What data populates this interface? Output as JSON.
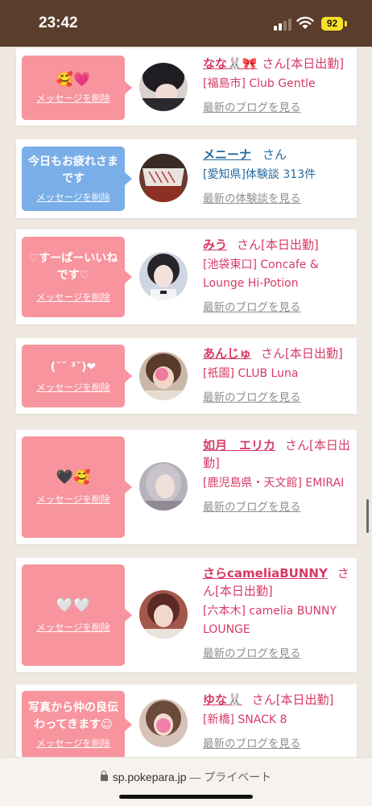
{
  "status": {
    "time": "23:42",
    "battery": "92"
  },
  "cards": [
    {
      "message": "🥰💗",
      "delete": "メッセージを削除",
      "name": "なな🐰🎀",
      "san": "さん",
      "tag": "[本日出勤]",
      "shop": "[福島市] Club Gentle",
      "link": "最新のブログを見る"
    },
    {
      "message": "今日もお疲れさまです",
      "delete": "メッセージを削除",
      "name": "メニーナ",
      "san": "さん",
      "tag": "",
      "shop": "[愛知県]体験談 313件",
      "link": "最新の体験談を見る"
    },
    {
      "message": "♡すーぱーいいねです♡",
      "delete": "メッセージを削除",
      "name": "みう",
      "san": "さん",
      "tag": "[本日出勤]",
      "shop": "[池袋東口] Concafe & Lounge Hi-Potion",
      "link": "最新のブログを見る"
    },
    {
      "message": "(˘˘ ³˘)❤",
      "delete": "メッセージを削除",
      "name": "あんじゅ",
      "san": "さん",
      "tag": "[本日出勤]",
      "shop": "[祇園] CLUB Luna",
      "link": "最新のブログを見る"
    },
    {
      "message": "🖤🥰",
      "delete": "メッセージを削除",
      "name": "如月　エリカ",
      "san": "さん",
      "tag": "[本日出勤]",
      "shop": "[鹿児島県・天文館] EMIRAI",
      "link": "最新のブログを見る"
    },
    {
      "message": "🤍🤍",
      "delete": "メッセージを削除",
      "name": "さらcameliaBUNNY",
      "san": "さん",
      "tag": "[本日出勤]",
      "shop": "[六本木] camelia BUNNY LOUNGE",
      "link": "最新のブログを見る"
    },
    {
      "message": "写真から仲の良伝わってきます☺",
      "delete": "メッセージを削除",
      "name": "ゆな🐰",
      "san": "さん",
      "tag": "[本日出勤]",
      "shop": "[新橋] SNACK 8",
      "link": "最新のブログを見る"
    }
  ],
  "urlbar": {
    "domain": "sp.pokepara.jp",
    "privacy": "— プライベート"
  },
  "colors": {
    "bubble_pink": "#f7949d",
    "bubble_blue": "#79aee8",
    "name_pink": "#d63a66",
    "name_blue": "#246a9c"
  }
}
